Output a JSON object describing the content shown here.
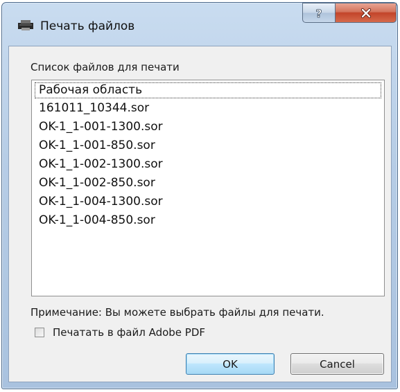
{
  "window": {
    "title": "Печать файлов",
    "help_label": "?",
    "close_label": "X"
  },
  "list": {
    "caption": "Список файлов для печати",
    "items": [
      {
        "label": "Рабочая область"
      },
      {
        "label": "161011_10344.sor"
      },
      {
        "label": "OK-1_1-001-1300.sor"
      },
      {
        "label": "OK-1_1-001-850.sor"
      },
      {
        "label": "OK-1_1-002-1300.sor"
      },
      {
        "label": "OK-1_1-002-850.sor"
      },
      {
        "label": "OK-1_1-004-1300.sor"
      },
      {
        "label": "OK-1_1-004-850.sor"
      }
    ]
  },
  "note": "Примечание: Вы можете выбрать файлы для печати.",
  "print_to_pdf": {
    "label": "Печатать в файл Adobe PDF",
    "checked": false
  },
  "buttons": {
    "ok_label": "OK",
    "cancel_label": "Cancel"
  }
}
